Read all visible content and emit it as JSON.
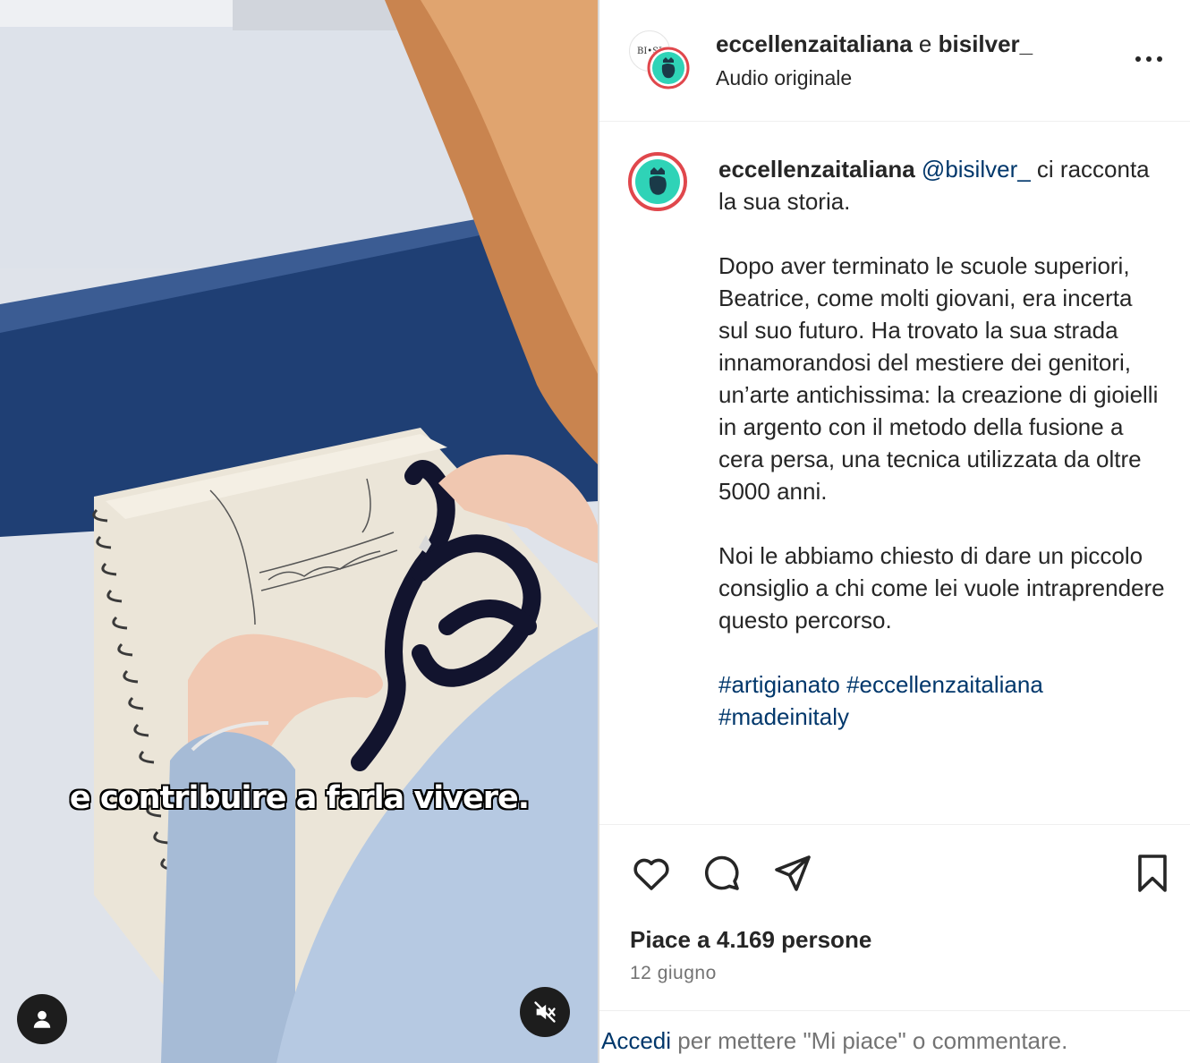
{
  "post": {
    "header": {
      "author": "eccellenzaitaliana",
      "connector": "e",
      "coauthor": "bisilver_",
      "audio": "Audio originale",
      "coauthor_logo_text": "BI•SI"
    },
    "video": {
      "subtitle": "e contribuire a farla vivere."
    },
    "caption": {
      "username": "eccellenzaitaliana",
      "mention": "@bisilver_",
      "body": " ci racconta la sua storia.\n\nDopo aver terminato le scuole superiori, Beatrice, come molti giovani, era incerta sul suo futuro. Ha trovato la sua strada innamorandosi del mestiere dei genitori, un’arte antichissima: la creazione di gioielli in argento con il metodo della fusione a cera persa, una tecnica utilizzata da oltre 5000 anni.\n\nNoi le abbiamo chiesto di dare un piccolo consiglio a chi come lei vuole intraprendere questo percorso.\n\n",
      "hashtags": "#artigianato #eccellenzaitaliana\n#madeinitaly"
    },
    "likes": "Piace a 4.169 persone",
    "date": "12 giugno",
    "login_prompt": {
      "link": "Accedi",
      "text": " per mettere \"Mi piace\" o commentare."
    }
  },
  "colors": {
    "link": "#00376b",
    "avatar_ring": "#e0474c",
    "avatar_fill": "#2fd3b7",
    "secondary_text": "#737373"
  },
  "icons": [
    "person-tag-icon",
    "mute-icon",
    "more-options-icon",
    "heart-icon",
    "comment-icon",
    "share-icon",
    "bookmark-icon"
  ]
}
